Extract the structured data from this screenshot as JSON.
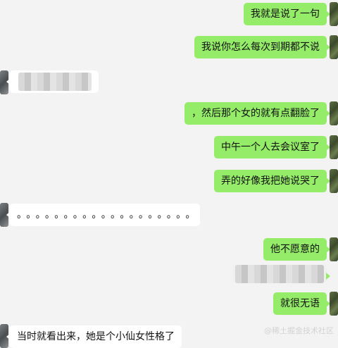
{
  "messages": [
    {
      "side": "sent",
      "text": "我就是说了一句"
    },
    {
      "side": "sent",
      "text": "我说你怎么每次到期都不说"
    },
    {
      "side": "received",
      "text": ""
    },
    {
      "side": "sent",
      "text": "，然后那个女的就有点翻脸了"
    },
    {
      "side": "sent",
      "text": "中午一个人去会议室了"
    },
    {
      "side": "sent",
      "text": "弄的好像我把她说哭了"
    },
    {
      "side": "received",
      "text": "。。。。。。。。。。。。。。。。。。。"
    },
    {
      "side": "sent",
      "text": "他不愿意的"
    },
    {
      "side": "sent",
      "text": ""
    },
    {
      "side": "sent",
      "text": "就很无语"
    },
    {
      "side": "received",
      "text": "当时就看出来，她是个小仙女性格了"
    }
  ],
  "watermark": "@稀土掘金技术社区",
  "colors": {
    "background": "#f3f3f3",
    "sent_bubble": "#95ec69",
    "received_bubble": "#ffffff"
  }
}
